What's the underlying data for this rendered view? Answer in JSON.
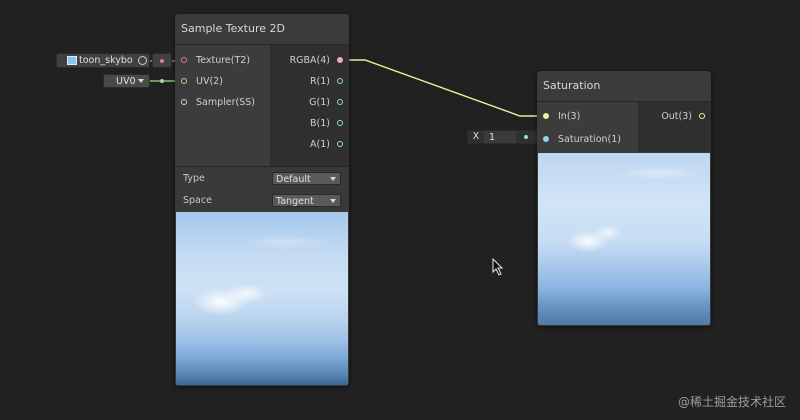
{
  "colors": {
    "background": "#212121",
    "node_body": "#393939",
    "texture_port": "#e57a86",
    "vector2_port": "#9be08f",
    "vector4_port": "#f4f0a4",
    "vector1_port": "#8fd8e8",
    "wire_color": "#f0ec9c"
  },
  "sample_texture_node": {
    "title": "Sample Texture 2D",
    "inputs": [
      {
        "label": "Texture(T2)"
      },
      {
        "label": "UV(2)"
      },
      {
        "label": "Sampler(SS)"
      }
    ],
    "outputs": [
      {
        "label": "RGBA(4)"
      },
      {
        "label": "R(1)"
      },
      {
        "label": "G(1)"
      },
      {
        "label": "B(1)"
      },
      {
        "label": "A(1)"
      }
    ],
    "properties": {
      "type_label": "Type",
      "type_value": "Default",
      "space_label": "Space",
      "space_value": "Tangent"
    }
  },
  "texture_field": {
    "value": "toon_skybo",
    "icon": "texture-icon"
  },
  "uv_field": {
    "value": "UV0"
  },
  "saturation_node": {
    "title": "Saturation",
    "inputs": [
      {
        "label": "In(3)"
      },
      {
        "label": "Saturation(1)"
      }
    ],
    "outputs": [
      {
        "label": "Out(3)"
      }
    ]
  },
  "saturation_field": {
    "axis_label": "X",
    "value": "1"
  },
  "watermark": "@稀土掘金技术社区"
}
